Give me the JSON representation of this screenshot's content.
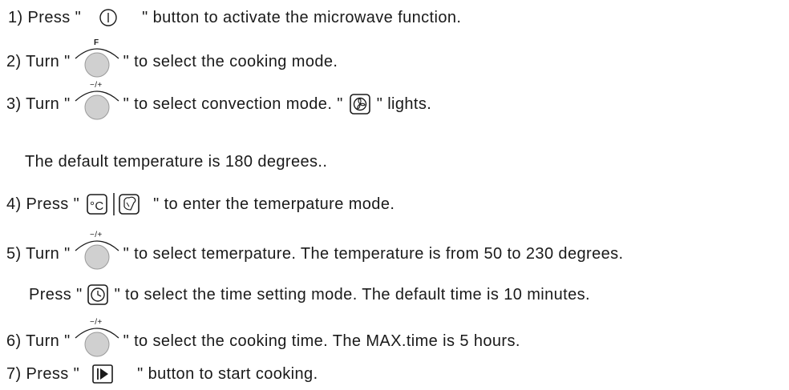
{
  "colors": {
    "text": "#1a1a1a",
    "knob": "#d0d0d0",
    "knob_edge": "#9a9a9a"
  },
  "steps": [
    {
      "prefix": "1) Press \"",
      "icon": "power-button-icon",
      "suffix": "\" button to activate the microwave function."
    },
    {
      "prefix": "2) Turn \"",
      "icon": "function-knob-icon",
      "dial_label": "F",
      "suffix": "\" to select the cooking mode."
    },
    {
      "prefix": "3) Turn \"",
      "icon": "adjust-knob-icon",
      "dial_label": "−/+",
      "middle": "\" to select convection mode. \"",
      "icon2": "convection-fan-icon",
      "suffix": "\" lights."
    },
    {
      "text": "The default temperature is 180 degrees.."
    },
    {
      "prefix": "4) Press \"",
      "icon": "temperature-weight-icon",
      "suffix": "\" to enter the temerpature mode."
    },
    {
      "prefix": "5) Turn \"",
      "icon": "adjust-knob-icon",
      "dial_label": "−/+",
      "suffix": "\" to select temerpature. The temperature is from 50 to 230 degrees."
    },
    {
      "prefix": "Press \"",
      "icon": "clock-icon",
      "suffix": "\" to select the time setting mode. The default time is 10 minutes."
    },
    {
      "prefix": "6) Turn \"",
      "icon": "adjust-knob-icon",
      "dial_label": "−/+",
      "suffix": "\" to select the cooking time. The MAX.time is 5 hours."
    },
    {
      "prefix": "7) Press \"",
      "icon": "start-button-icon",
      "suffix": "\" button to start cooking."
    }
  ]
}
